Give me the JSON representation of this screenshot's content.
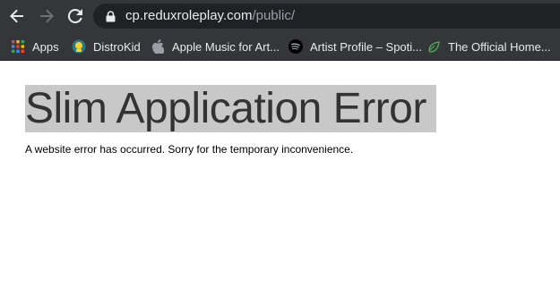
{
  "browser": {
    "url_host": "cp.reduxroleplay.com",
    "url_path": "/public/",
    "bookmarks": [
      {
        "label": "Apps",
        "icon": "apps-grid-icon"
      },
      {
        "label": "DistroKid",
        "icon": "distrokid-icon"
      },
      {
        "label": "Apple Music for Art...",
        "icon": "apple-icon"
      },
      {
        "label": "Artist Profile – Spoti...",
        "icon": "spotify-icon"
      },
      {
        "label": "The Official Home...",
        "icon": "leaf-icon"
      }
    ]
  },
  "page": {
    "title": "Slim Application Error",
    "message": "A website error has occurred. Sorry for the temporary inconvenience."
  }
}
